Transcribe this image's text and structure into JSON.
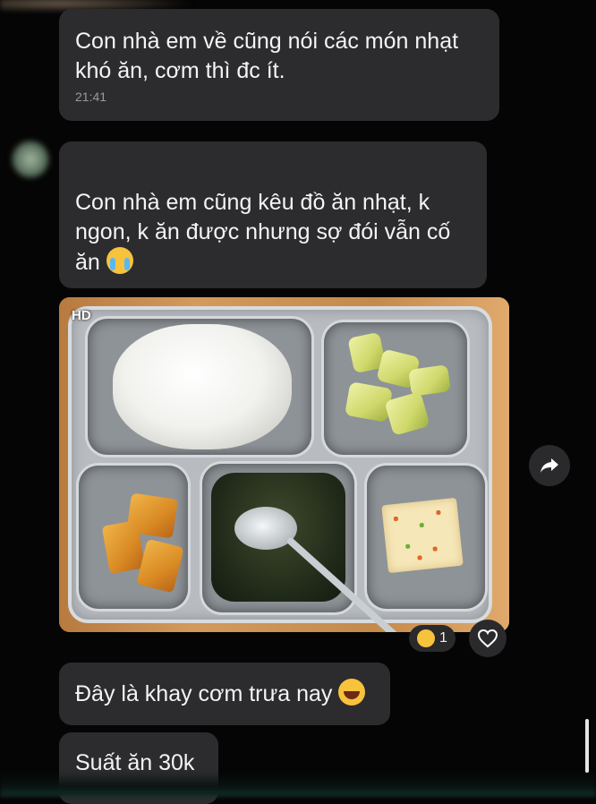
{
  "messages": [
    {
      "text_line1": "Con nhà em về cũng nói các món nhạt",
      "text_line2": "khó ăn, cơm thì đc ít.",
      "time": "21:41"
    },
    {
      "text_line1": "Con nhà em cũng kêu đồ ăn nhạt, k",
      "text_line2": "ngon, k ăn được nhưng sợ đói vẫn cố",
      "text_line3": "ăn",
      "emoji": "crying-face-emoji"
    },
    {
      "photo_badge": "HD",
      "reaction_count": "1",
      "reaction_emoji": "kissing-face-emoji"
    },
    {
      "text": "Đây là khay cơm trưa nay",
      "emoji": "laughing-face-emoji"
    },
    {
      "text": "Suất ăn 30k"
    }
  ],
  "icons": {
    "share": "share-arrow-icon",
    "like": "heart-outline-icon"
  },
  "colors": {
    "background": "#050505",
    "bubble": "#2c2c2e",
    "text": "#f4f4f4",
    "timestamp": "#9a9a9a"
  }
}
